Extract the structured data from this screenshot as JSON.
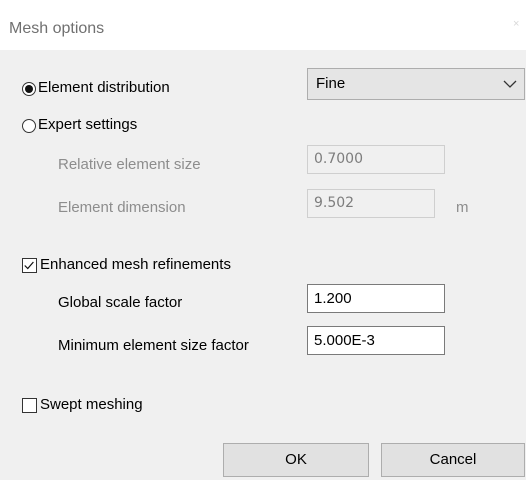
{
  "window": {
    "title": "Mesh options",
    "close_glyph": "×"
  },
  "distribution": {
    "element_distribution_label": "Element distribution",
    "element_distribution_selected": true,
    "selected_option": "Fine",
    "expert_settings_label": "Expert settings",
    "expert_settings_selected": false
  },
  "expert": {
    "relative_element_size_label": "Relative element size",
    "relative_element_size_value": "0.7000",
    "element_dimension_label": "Element dimension",
    "element_dimension_value": "9.502",
    "element_dimension_unit": "m"
  },
  "refinements": {
    "enhanced_label": "Enhanced mesh refinements",
    "enhanced_checked": true,
    "global_scale_label": "Global scale factor",
    "global_scale_value": "1.200",
    "min_element_size_label": "Minimum element size factor",
    "min_element_size_value": "5.000E-3"
  },
  "swept": {
    "label": "Swept meshing",
    "checked": false
  },
  "buttons": {
    "ok": "OK",
    "cancel": "Cancel"
  },
  "icons": {
    "dropdown": "chevron-down-icon",
    "checkbox_check": "checkmark-icon"
  }
}
